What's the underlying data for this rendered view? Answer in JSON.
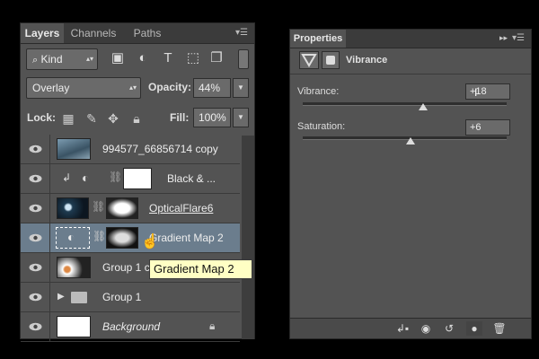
{
  "layers_panel": {
    "tabs": [
      {
        "label": "Layers",
        "active": true
      },
      {
        "label": "Channels",
        "active": false
      },
      {
        "label": "Paths",
        "active": false
      }
    ],
    "filter": {
      "label": "Kind"
    },
    "blend_mode": "Overlay",
    "opacity": {
      "label": "Opacity:",
      "value": "44%"
    },
    "lock_label": "Lock:",
    "fill": {
      "label": "Fill:",
      "value": "100%"
    },
    "layers": [
      {
        "name": "994577_66856714 copy",
        "italic": false,
        "selected": false
      },
      {
        "name": "Black & ...",
        "italic": false,
        "selected": false
      },
      {
        "name": "OpticalFlare6",
        "italic": false,
        "selected": false
      },
      {
        "name": "Gradient Map 2",
        "italic": false,
        "selected": true
      },
      {
        "name": "Group 1 c",
        "italic": false,
        "selected": false
      },
      {
        "name": "Group 1",
        "italic": false,
        "selected": false
      },
      {
        "name": "Background",
        "italic": true,
        "selected": false
      }
    ],
    "tooltip": "Gradient Map 2"
  },
  "properties_panel": {
    "title": "Properties",
    "adjustment_name": "Vibrance",
    "vibrance": {
      "label": "Vibrance:",
      "value": "+18",
      "level": 0.59
    },
    "saturation": {
      "label": "Saturation:",
      "value": "+6",
      "level": 0.53
    }
  },
  "colors": {
    "panel_bg": "#535353",
    "selected_layer": "#6b7d8d",
    "tooltip_bg": "#ffffc4"
  }
}
